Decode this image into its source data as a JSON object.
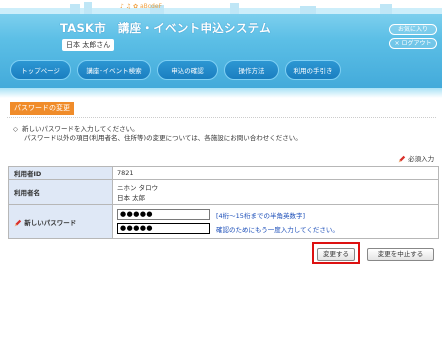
{
  "header": {
    "title": "TASK市　講座・イベント申込システム",
    "user_name": "日本 太郎さん",
    "favorites_label": "お気に入り",
    "logout_label": "× ログアウト",
    "deco_text": "♪ ♫  ✿  aBcdeF"
  },
  "nav": {
    "items": [
      {
        "label": "トップページ"
      },
      {
        "label": "講座･イベント検索"
      },
      {
        "label": "申込の確認"
      },
      {
        "label": "操作方法"
      },
      {
        "label": "利用の手引き"
      }
    ]
  },
  "section": {
    "title": "パスワードの変更"
  },
  "instructions": {
    "line1": "新しいパスワードを入力してください。",
    "line2": "パスワード以外の項目(利用者名、住所等)の変更については、各施設にお問い合わせください。"
  },
  "required_note": "必須入力",
  "form": {
    "user_id_label": "利用者ID",
    "user_id_value": "7821",
    "user_name_label": "利用者名",
    "user_name_kana": "ニホン タロウ",
    "user_name_kanji": "日本 太郎",
    "new_password_label": "新しいパスワード",
    "password_value": "●●●●●",
    "password_confirm_value": "●●●●●",
    "password_hint": "[4桁～15桁までの半角英数字]",
    "confirm_hint": "確認のためにもう一度入力してください。"
  },
  "actions": {
    "submit_label": "変更する",
    "cancel_label": "変更を中止する"
  },
  "colors": {
    "header_blue": "#3ea6d8",
    "section_orange": "#f08c2a",
    "highlight_red": "#dd1111",
    "label_bg": "#dfe8f6",
    "hint_blue": "#1a4db8"
  }
}
